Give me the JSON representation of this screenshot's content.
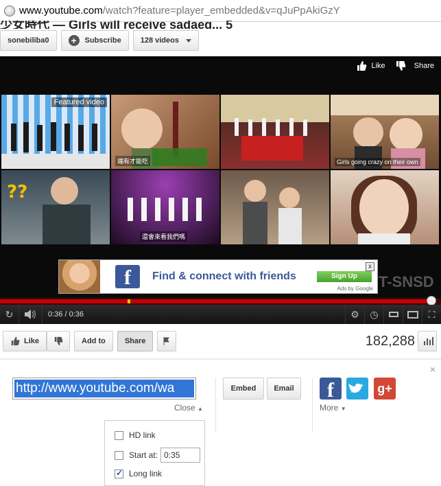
{
  "browser": {
    "url_host": "www.youtube.com",
    "url_rest": "/watch?feature=player_embedded&v=qJuPpAkiGzY"
  },
  "page": {
    "title_fragment": "少女時代 — Girls will receive sadaeg... 5"
  },
  "channel": {
    "name": "sonebiliba0",
    "subscribe_label": "Subscribe",
    "videos_label": "128 videos"
  },
  "player": {
    "like_label": "Like",
    "share_label": "Share",
    "featured_label": "Featured video",
    "thumbnails": [
      {
        "caption": ""
      },
      {
        "caption": "端有才能吃"
      },
      {
        "caption": ""
      },
      {
        "caption": "Girls going crazy on their own"
      },
      {
        "caption": ""
      },
      {
        "caption": "還會來看我們嗎"
      },
      {
        "caption": ""
      },
      {
        "caption": ""
      }
    ],
    "ad": {
      "text": "Find & connect with friends",
      "signup": "Sign Up",
      "attribution": "Ads by Google",
      "close": "x",
      "fb_letter": "f"
    },
    "watermark": "T-SNSD",
    "time": "0:36 / 0:36",
    "progress": {
      "played_fraction": 0.978,
      "buffered_marker_fraction": 0.29
    }
  },
  "actions": {
    "like": "Like",
    "add_to": "Add to",
    "share": "Share",
    "views": "182,288"
  },
  "share_panel": {
    "url": "http://www.youtube.com/wa",
    "close": "Close",
    "embed": "Embed",
    "email": "Email",
    "more": "More",
    "dismiss": "×",
    "options": [
      {
        "label": "HD link",
        "checked": false
      },
      {
        "label": "Start at:",
        "checked": false,
        "value": "0:35"
      },
      {
        "label": "Long link",
        "checked": true
      }
    ]
  },
  "colors": {
    "progress_red": "#c40000",
    "facebook_blue": "#3b5998",
    "twitter_blue": "#2aa9e0",
    "gplus_red": "#d14836",
    "selection_blue": "#3176d6"
  }
}
